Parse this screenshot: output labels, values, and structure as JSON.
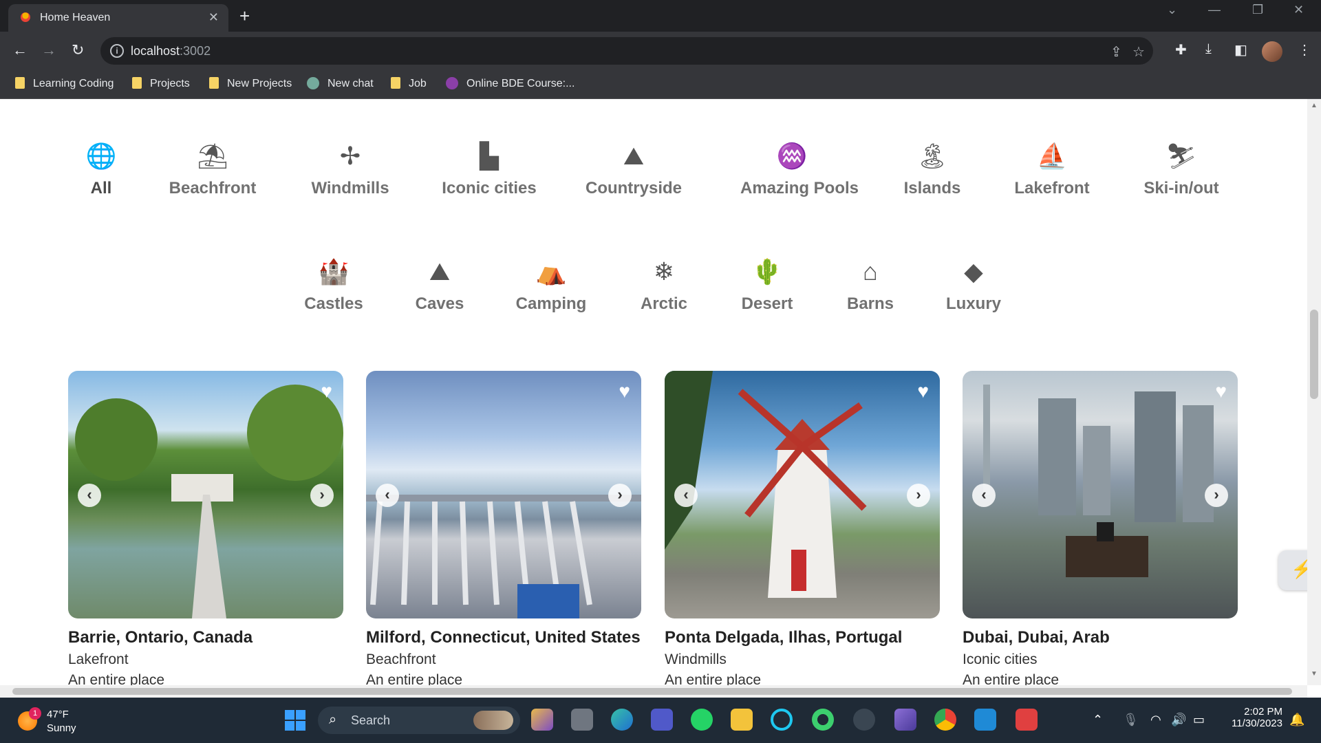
{
  "browser": {
    "tab_title": "Home Heaven",
    "url_host": "localhost",
    "url_port": ":3002",
    "bookmarks": [
      "Learning Coding",
      "Projects",
      "New Projects",
      "New chat",
      "Job",
      "Online BDE Course:..."
    ]
  },
  "categories_row1": [
    {
      "label": "All",
      "icon": "globe-icon",
      "glyph": "🌐"
    },
    {
      "label": "Beachfront",
      "icon": "beach-umbrella-icon",
      "glyph": "⛱"
    },
    {
      "label": "Windmills",
      "icon": "windmill-icon",
      "glyph": "✢"
    },
    {
      "label": "Iconic cities",
      "icon": "city-icon",
      "glyph": "▙"
    },
    {
      "label": "Countryside",
      "icon": "mountain-icon",
      "glyph": "⛰"
    },
    {
      "label": "Amazing Pools",
      "icon": "pool-icon",
      "glyph": "♒"
    },
    {
      "label": "Islands",
      "icon": "palm-island-icon",
      "glyph": "🏝"
    },
    {
      "label": "Lakefront",
      "icon": "fishing-icon",
      "glyph": "⛵"
    },
    {
      "label": "Ski-in/out",
      "icon": "skier-icon",
      "glyph": "⛷"
    }
  ],
  "categories_row2": [
    {
      "label": "Castles",
      "icon": "castle-icon",
      "glyph": "🏰"
    },
    {
      "label": "Caves",
      "icon": "cave-icon",
      "glyph": "⛰"
    },
    {
      "label": "Camping",
      "icon": "tent-icon",
      "glyph": "⛺"
    },
    {
      "label": "Arctic",
      "icon": "snowflake-icon",
      "glyph": "❄"
    },
    {
      "label": "Desert",
      "icon": "cactus-icon",
      "glyph": "🌵"
    },
    {
      "label": "Barns",
      "icon": "barn-icon",
      "glyph": "⌂"
    },
    {
      "label": "Luxury",
      "icon": "diamond-icon",
      "glyph": "◆"
    }
  ],
  "listings": [
    {
      "location": "Barrie, Ontario, Canada",
      "category": "Lakefront",
      "place": "An entire place"
    },
    {
      "location": "Milford, Connecticut, United States",
      "category": "Beachfront",
      "place": "An entire place"
    },
    {
      "location": "Ponta Delgada, Ilhas, Portugal",
      "category": "Windmills",
      "place": "An entire place"
    },
    {
      "location": "Dubai, Dubai, Arab",
      "category": "Iconic cities",
      "place": "An entire place"
    }
  ],
  "taskbar": {
    "weather_temp": "47°F",
    "weather_cond": "Sunny",
    "weather_badge": "1",
    "search_placeholder": "Search",
    "time": "2:02 PM",
    "date": "11/30/2023"
  }
}
